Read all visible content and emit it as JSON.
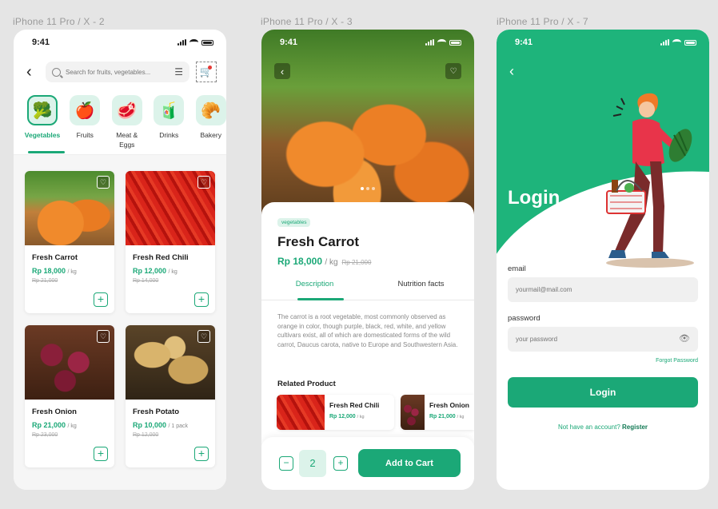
{
  "frames": [
    "iPhone 11 Pro / X - 2",
    "iPhone 11 Pro / X - 3",
    "iPhone 11 Pro / X - 7"
  ],
  "status_time": "9:41",
  "home": {
    "search_placeholder": "Search for fruits, vegetables...",
    "categories": [
      {
        "label": "Vegetables",
        "icon": "broccoli-icon"
      },
      {
        "label": "Fruits",
        "icon": "apple-icon"
      },
      {
        "label": "Meat & Eggs",
        "icon": "meat-icon"
      },
      {
        "label": "Drinks",
        "icon": "drink-icon"
      },
      {
        "label": "Bakery",
        "icon": "bread-icon"
      }
    ],
    "products": [
      {
        "name": "Fresh Carrot",
        "price": "Rp 18,000",
        "unit": "/ kg",
        "old": "Rp 21,000"
      },
      {
        "name": "Fresh Red Chili",
        "price": "Rp 12,000",
        "unit": "/ kg",
        "old": "Rp 14,000"
      },
      {
        "name": "Fresh Onion",
        "price": "Rp 21,000",
        "unit": "/ kg",
        "old": "Rp 23,000"
      },
      {
        "name": "Fresh Potato",
        "price": "Rp 10,000",
        "unit": "/ 1 pack",
        "old": "Rp 12,000"
      }
    ]
  },
  "detail": {
    "tag": "vegetables",
    "title": "Fresh Carrot",
    "price": "Rp 18,000",
    "unit": "/ kg",
    "old": "Rp 21,000",
    "tabs": [
      "Description",
      "Nutrition facts"
    ],
    "description": "The carrot is a root vegetable, most commonly observed as orange in color, though purple, black, red, white, and yellow cultivars exist, all of which are domesticated forms of the wild carrot, Daucus carota, native to Europe and Southwestern Asia.",
    "related_title": "Related Product",
    "related": [
      {
        "name": "Fresh Red Chili",
        "price": "Rp 12,000",
        "unit": "/ kg"
      },
      {
        "name": "Fresh Onion",
        "price": "Rp 21,000",
        "unit": "/ kg"
      }
    ],
    "quantity": "2",
    "minus": "−",
    "plus": "+",
    "add_to_cart": "Add to Cart"
  },
  "login": {
    "title": "Login",
    "email_label": "email",
    "email_placeholder": "yourmail@mail.com",
    "password_label": "password",
    "password_placeholder": "your password",
    "forgot": "Forgot Password",
    "button": "Login",
    "register_prompt": "Not have an account?",
    "register_link": "Register"
  },
  "colors": {
    "accent": "#1ba877",
    "accent_light": "#dcf3ea",
    "login_bg": "#1eb47b"
  }
}
